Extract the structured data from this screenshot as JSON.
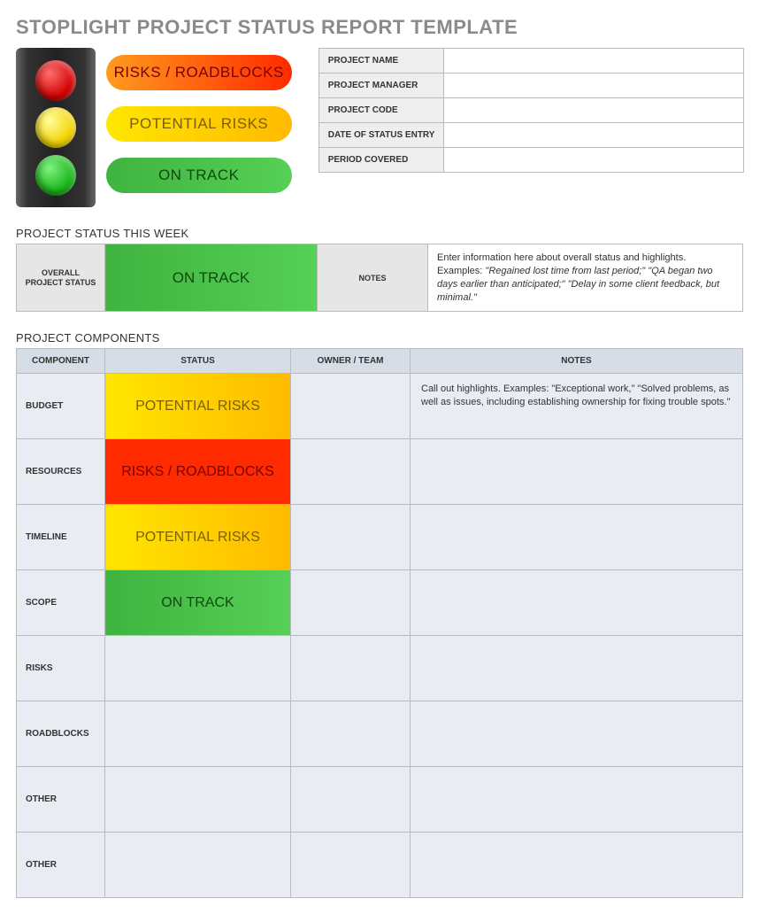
{
  "title": "STOPLIGHT PROJECT STATUS REPORT TEMPLATE",
  "legend": {
    "red": "RISKS / ROADBLOCKS",
    "yellow": "POTENTIAL RISKS",
    "green": "ON TRACK"
  },
  "info": {
    "rows": [
      {
        "label": "PROJECT NAME",
        "value": ""
      },
      {
        "label": "PROJECT MANAGER",
        "value": ""
      },
      {
        "label": "PROJECT CODE",
        "value": ""
      },
      {
        "label": "DATE OF STATUS ENTRY",
        "value": ""
      },
      {
        "label": "PERIOD COVERED",
        "value": ""
      }
    ]
  },
  "week_section_title": "PROJECT STATUS THIS WEEK",
  "week": {
    "overall_label": "OVERALL PROJECT STATUS",
    "status_text": "ON TRACK",
    "status_level": "green",
    "notes_label": "NOTES",
    "notes_html": "Enter information here about overall status and highlights. Examples: <i>\"Regained lost time from last period;\" \"QA began two days earlier than anticipated;\" \"Delay in some client feedback, but minimal.\"</i>"
  },
  "components_section_title": "PROJECT COMPONENTS",
  "components": {
    "headers": {
      "c1": "COMPONENT",
      "c2": "STATUS",
      "c3": "OWNER / TEAM",
      "c4": "NOTES"
    },
    "rows": [
      {
        "name": "BUDGET",
        "status_text": "POTENTIAL RISKS",
        "status_level": "yellow",
        "owner": "",
        "notes": "Call out highlights. Examples: \"Exceptional work,\" \"Solved problems, as well as issues, including establishing ownership for fixing trouble spots.\""
      },
      {
        "name": "RESOURCES",
        "status_text": "RISKS / ROADBLOCKS",
        "status_level": "red",
        "owner": "",
        "notes": ""
      },
      {
        "name": "TIMELINE",
        "status_text": "POTENTIAL RISKS",
        "status_level": "yellow",
        "owner": "",
        "notes": ""
      },
      {
        "name": "SCOPE",
        "status_text": "ON TRACK",
        "status_level": "green",
        "owner": "",
        "notes": ""
      },
      {
        "name": "RISKS",
        "status_text": "",
        "status_level": "",
        "owner": "",
        "notes": ""
      },
      {
        "name": "ROADBLOCKS",
        "status_text": "",
        "status_level": "",
        "owner": "",
        "notes": ""
      },
      {
        "name": "OTHER",
        "status_text": "",
        "status_level": "",
        "owner": "",
        "notes": ""
      },
      {
        "name": "OTHER",
        "status_text": "",
        "status_level": "",
        "owner": "",
        "notes": ""
      }
    ]
  }
}
